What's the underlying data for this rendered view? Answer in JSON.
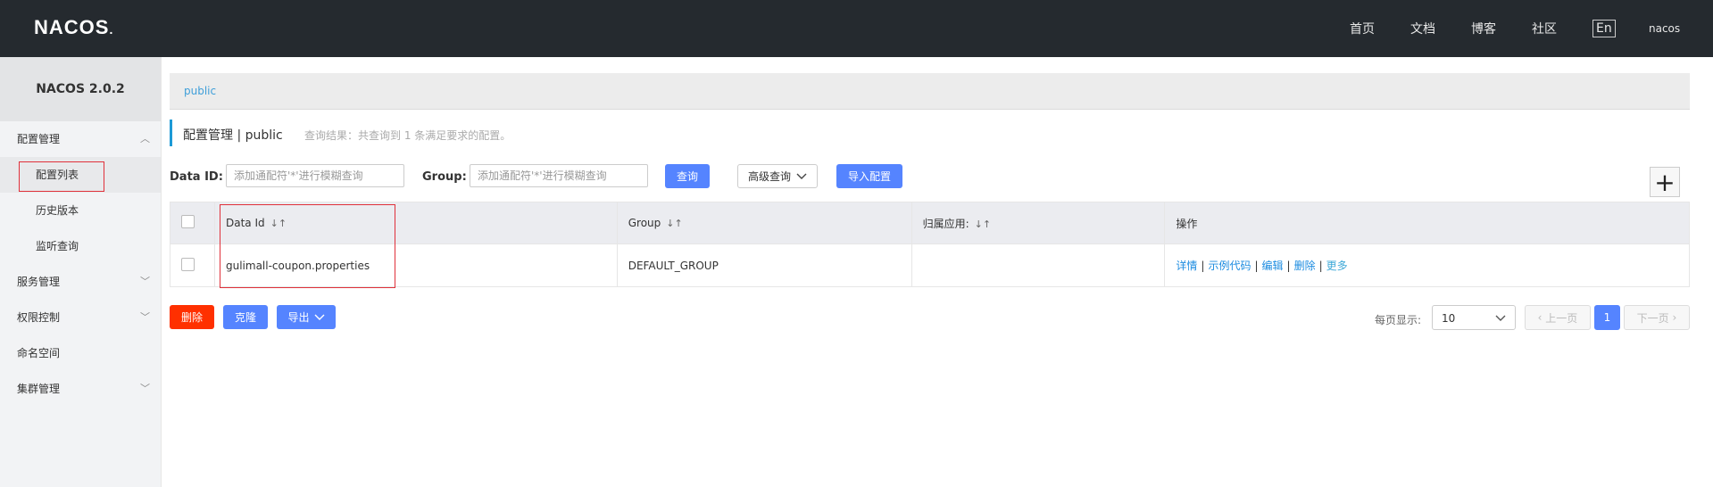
{
  "app": {
    "logo": "NACOS",
    "logo_dot": "."
  },
  "topnav": {
    "home": "首页",
    "docs": "文档",
    "blog": "博客",
    "community": "社区",
    "lang": "En",
    "user": "nacos"
  },
  "sidebar": {
    "title": "NACOS 2.0.2",
    "items": [
      {
        "label": "配置管理"
      },
      {
        "label": "配置列表"
      },
      {
        "label": "历史版本"
      },
      {
        "label": "监听查询"
      },
      {
        "label": "服务管理"
      },
      {
        "label": "权限控制"
      },
      {
        "label": "命名空间"
      },
      {
        "label": "集群管理"
      }
    ]
  },
  "breadcrumb": {
    "namespace": "public"
  },
  "page": {
    "title": "配置管理  |  public",
    "result": "查询结果：共查询到 1 条满足要求的配置。"
  },
  "search": {
    "dataid_label": "Data ID:",
    "dataid_placeholder": "添加通配符'*'进行模糊查询",
    "group_label": "Group:",
    "group_placeholder": "添加通配符'*'进行模糊查询",
    "query_btn": "查询",
    "advanced_btn": "高级查询",
    "import_btn": "导入配置"
  },
  "table": {
    "headers": {
      "dataid": "Data Id",
      "group": "Group",
      "app": "归属应用:",
      "ops": "操作"
    },
    "rows": [
      {
        "dataid": "gulimall-coupon.properties",
        "group": "DEFAULT_GROUP",
        "app": ""
      }
    ],
    "ops": {
      "detail": "详情",
      "sample": "示例代码",
      "edit": "编辑",
      "delete": "删除",
      "more": "更多"
    }
  },
  "bottom": {
    "delete_btn": "删除",
    "clone_btn": "克隆",
    "export_btn": "导出"
  },
  "pager": {
    "per_page_label": "每页显示:",
    "per_page": "10",
    "prev": "上一页",
    "current": "1",
    "next": "下一页"
  },
  "colors": {
    "topbar": "#252a2f",
    "primary": "#5584ff",
    "danger": "#ff3000",
    "highlight_box": "#e0303a"
  }
}
